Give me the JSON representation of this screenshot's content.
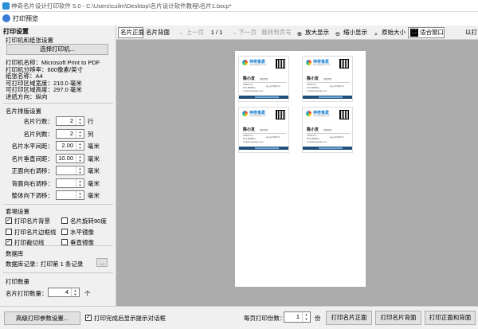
{
  "window": {
    "app_title": "神奇名片设计打印软件 5.0 - C:\\Users\\cuilm\\Desktop\\名片设计软件教程\\名片1.bscp*",
    "dialog_title": "打印预览"
  },
  "left": {
    "heading": "打印设置",
    "printer_section": "打印机和纸张设置",
    "select_printer_button": "选择打印机...",
    "printer_info": [
      "打印机名称：Microsoft Print to PDF",
      "打印机分辨率：600像素/英寸",
      "纸张名称：A4",
      "可打印区域宽度：210.0 毫米",
      "可打印区域高度：297.0 毫米",
      "进纸方向：纵向"
    ],
    "layout_section": "名片排版设置",
    "layout_rows": [
      {
        "label": "名片行数：",
        "value": "2",
        "unit": "行"
      },
      {
        "label": "名片列数：",
        "value": "2",
        "unit": "列"
      },
      {
        "label": "名片水平间距：",
        "value": "2.00",
        "unit": "毫米"
      },
      {
        "label": "名片垂直间距：",
        "value": "10.00",
        "unit": "毫米"
      },
      {
        "label": "正面向右调移：",
        "value": "",
        "unit": "毫米"
      },
      {
        "label": "背面向右调移：",
        "value": "",
        "unit": "毫米"
      },
      {
        "label": "整体向下调移：",
        "value": "",
        "unit": "毫米"
      }
    ],
    "other_section": "套埸设置",
    "checkboxes": [
      {
        "label": "打印名片背景",
        "checked": true
      },
      {
        "label": "名片旋转90度",
        "checked": false
      },
      {
        "label": "打印名片边框线",
        "checked": false
      },
      {
        "label": "水平镜像",
        "checked": false
      },
      {
        "label": "打印裁切线",
        "checked": true
      },
      {
        "label": "垂直镜像",
        "checked": false
      }
    ],
    "db_section": "数据库",
    "db_label": "数据库记录：",
    "db_value": "打印第 1 条记录",
    "db_button": "...",
    "qty_section": "打印数量",
    "qty_label": "名片打印数量：",
    "qty_value": "4",
    "qty_unit": "个"
  },
  "toolbar": {
    "front": "名片正面",
    "back": "名片背面",
    "prev": "上一页",
    "page": "1 / 1",
    "next": "下一页",
    "jump": "跳转到页号",
    "zoom_in": "放大显示",
    "zoom_out": "缩小显示",
    "original": "原始大小",
    "fit": "适合窗口",
    "print": "以打"
  },
  "card": {
    "brand": "神奇像素",
    "site": "shenqixiangsu.com",
    "name": "陈小友",
    "role": "销售经理",
    "lines": [
      "13800177xx",
      "0571-888888xx",
      "xxx@shenqixiangsu.com"
    ],
    "addr": "杭州市XX路XX号"
  },
  "bottom": {
    "advanced": "高级打印参数设置...",
    "show_dialog": "打印完成后显示提示对话框",
    "per_page_label": "每页打印份数：",
    "per_page_value": "1",
    "per_page_unit": "份",
    "print_front": "打印名片正面",
    "print_back": "打印名片背面",
    "print_both": "打印正面和背面"
  },
  "colors": {
    "accent": "#1a7fd0",
    "card_bar": "#1f4e79",
    "preview_bg": "#ababab"
  }
}
